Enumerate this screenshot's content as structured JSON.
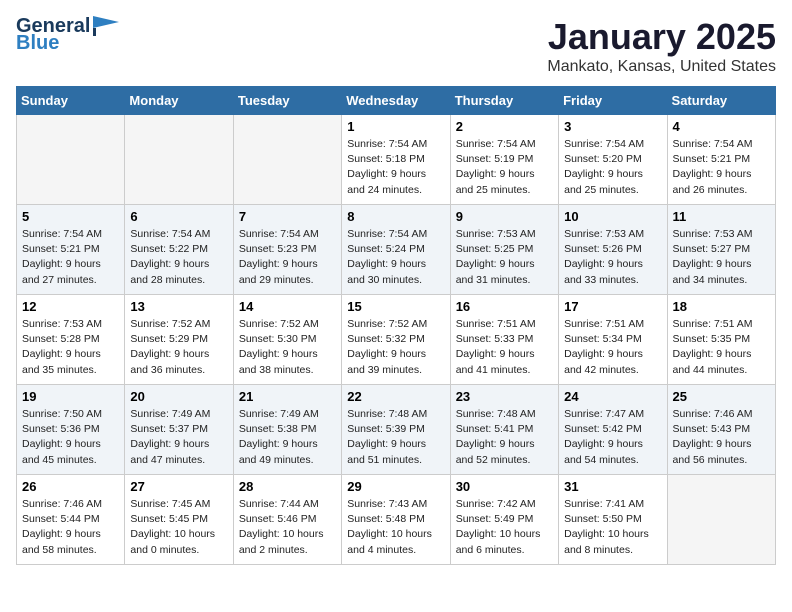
{
  "header": {
    "logo_line1": "General",
    "logo_line2": "Blue",
    "title": "January 2025",
    "subtitle": "Mankato, Kansas, United States"
  },
  "weekdays": [
    "Sunday",
    "Monday",
    "Tuesday",
    "Wednesday",
    "Thursday",
    "Friday",
    "Saturday"
  ],
  "weeks": [
    [
      {
        "day": "",
        "empty": true
      },
      {
        "day": "",
        "empty": true
      },
      {
        "day": "",
        "empty": true
      },
      {
        "day": "1",
        "info": "Sunrise: 7:54 AM\nSunset: 5:18 PM\nDaylight: 9 hours\nand 24 minutes."
      },
      {
        "day": "2",
        "info": "Sunrise: 7:54 AM\nSunset: 5:19 PM\nDaylight: 9 hours\nand 25 minutes."
      },
      {
        "day": "3",
        "info": "Sunrise: 7:54 AM\nSunset: 5:20 PM\nDaylight: 9 hours\nand 25 minutes."
      },
      {
        "day": "4",
        "info": "Sunrise: 7:54 AM\nSunset: 5:21 PM\nDaylight: 9 hours\nand 26 minutes."
      }
    ],
    [
      {
        "day": "5",
        "info": "Sunrise: 7:54 AM\nSunset: 5:21 PM\nDaylight: 9 hours\nand 27 minutes."
      },
      {
        "day": "6",
        "info": "Sunrise: 7:54 AM\nSunset: 5:22 PM\nDaylight: 9 hours\nand 28 minutes."
      },
      {
        "day": "7",
        "info": "Sunrise: 7:54 AM\nSunset: 5:23 PM\nDaylight: 9 hours\nand 29 minutes."
      },
      {
        "day": "8",
        "info": "Sunrise: 7:54 AM\nSunset: 5:24 PM\nDaylight: 9 hours\nand 30 minutes."
      },
      {
        "day": "9",
        "info": "Sunrise: 7:53 AM\nSunset: 5:25 PM\nDaylight: 9 hours\nand 31 minutes."
      },
      {
        "day": "10",
        "info": "Sunrise: 7:53 AM\nSunset: 5:26 PM\nDaylight: 9 hours\nand 33 minutes."
      },
      {
        "day": "11",
        "info": "Sunrise: 7:53 AM\nSunset: 5:27 PM\nDaylight: 9 hours\nand 34 minutes."
      }
    ],
    [
      {
        "day": "12",
        "info": "Sunrise: 7:53 AM\nSunset: 5:28 PM\nDaylight: 9 hours\nand 35 minutes."
      },
      {
        "day": "13",
        "info": "Sunrise: 7:52 AM\nSunset: 5:29 PM\nDaylight: 9 hours\nand 36 minutes."
      },
      {
        "day": "14",
        "info": "Sunrise: 7:52 AM\nSunset: 5:30 PM\nDaylight: 9 hours\nand 38 minutes."
      },
      {
        "day": "15",
        "info": "Sunrise: 7:52 AM\nSunset: 5:32 PM\nDaylight: 9 hours\nand 39 minutes."
      },
      {
        "day": "16",
        "info": "Sunrise: 7:51 AM\nSunset: 5:33 PM\nDaylight: 9 hours\nand 41 minutes."
      },
      {
        "day": "17",
        "info": "Sunrise: 7:51 AM\nSunset: 5:34 PM\nDaylight: 9 hours\nand 42 minutes."
      },
      {
        "day": "18",
        "info": "Sunrise: 7:51 AM\nSunset: 5:35 PM\nDaylight: 9 hours\nand 44 minutes."
      }
    ],
    [
      {
        "day": "19",
        "info": "Sunrise: 7:50 AM\nSunset: 5:36 PM\nDaylight: 9 hours\nand 45 minutes."
      },
      {
        "day": "20",
        "info": "Sunrise: 7:49 AM\nSunset: 5:37 PM\nDaylight: 9 hours\nand 47 minutes."
      },
      {
        "day": "21",
        "info": "Sunrise: 7:49 AM\nSunset: 5:38 PM\nDaylight: 9 hours\nand 49 minutes."
      },
      {
        "day": "22",
        "info": "Sunrise: 7:48 AM\nSunset: 5:39 PM\nDaylight: 9 hours\nand 51 minutes."
      },
      {
        "day": "23",
        "info": "Sunrise: 7:48 AM\nSunset: 5:41 PM\nDaylight: 9 hours\nand 52 minutes."
      },
      {
        "day": "24",
        "info": "Sunrise: 7:47 AM\nSunset: 5:42 PM\nDaylight: 9 hours\nand 54 minutes."
      },
      {
        "day": "25",
        "info": "Sunrise: 7:46 AM\nSunset: 5:43 PM\nDaylight: 9 hours\nand 56 minutes."
      }
    ],
    [
      {
        "day": "26",
        "info": "Sunrise: 7:46 AM\nSunset: 5:44 PM\nDaylight: 9 hours\nand 58 minutes."
      },
      {
        "day": "27",
        "info": "Sunrise: 7:45 AM\nSunset: 5:45 PM\nDaylight: 10 hours\nand 0 minutes."
      },
      {
        "day": "28",
        "info": "Sunrise: 7:44 AM\nSunset: 5:46 PM\nDaylight: 10 hours\nand 2 minutes."
      },
      {
        "day": "29",
        "info": "Sunrise: 7:43 AM\nSunset: 5:48 PM\nDaylight: 10 hours\nand 4 minutes."
      },
      {
        "day": "30",
        "info": "Sunrise: 7:42 AM\nSunset: 5:49 PM\nDaylight: 10 hours\nand 6 minutes."
      },
      {
        "day": "31",
        "info": "Sunrise: 7:41 AM\nSunset: 5:50 PM\nDaylight: 10 hours\nand 8 minutes."
      },
      {
        "day": "",
        "empty": true
      }
    ]
  ]
}
